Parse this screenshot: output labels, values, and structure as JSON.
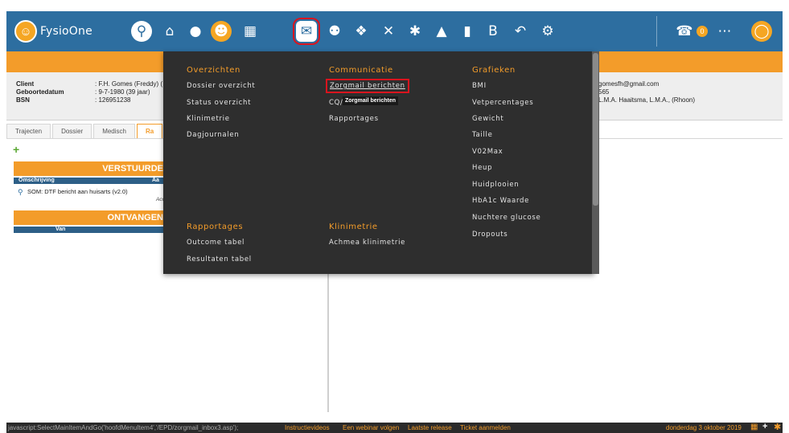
{
  "app": {
    "logo_text": "FysioOne"
  },
  "nav": {
    "icons": [
      "search-icon",
      "home-icon",
      "person-icon",
      "group-icon",
      "calendar-icon",
      "mail-icon",
      "money-icon",
      "handshake-icon",
      "exercise-icon",
      "body-icon",
      "organization-icon",
      "chart-icon",
      "b-icon",
      "back-icon",
      "settings-icon",
      "support-icon",
      "more-icon",
      "user-icon"
    ],
    "badge": "0"
  },
  "client": {
    "label_client": "Client",
    "label_birth": "Geboortedatum",
    "label_bsn": "BSN",
    "value_client": ": F.H. Gomes (Freddy) (",
    "value_birth": ": 9-7-1980 (39 jaar)",
    "value_bsn": ": 126951238",
    "right_email": "gomesfh@gmail.com",
    "right_phone": "565",
    "right_practitioner": "L.M.A. Haaitsma, L.M.A., (Rhoon)"
  },
  "tabs": [
    "Trajecten",
    "Dossier",
    "Medisch",
    "Ra"
  ],
  "left_panel": {
    "sent_title": "VERSTUURDE",
    "sent_col_desc": "Omschrijving",
    "sent_col_aan": "Aa",
    "sent_row_desc": "SOM: DTF bericht aan huisarts (v2.0)",
    "sent_row_meta": "Acc",
    "received_title": "ONTVANGEN",
    "received_col_van": "Van"
  },
  "dropdown": {
    "col1_title": "Overzichten",
    "col1_items": [
      "Dossier overzicht",
      "Status overzicht",
      "Klinimetrie",
      "Dagjournalen"
    ],
    "col2_title": "Communicatie",
    "col2_items": [
      "Zorgmail berichten",
      "CQ/FP",
      "Rapportages"
    ],
    "tooltip": "Zorgmail berichten",
    "col3_title": "Grafieken",
    "col3_items": [
      "BMI",
      "Vetpercentages",
      "Gewicht",
      "Taille",
      "V02Max",
      "Heup",
      "Huidplooien",
      "HbA1c Waarde",
      "Nuchtere glucose",
      "Dropouts"
    ],
    "col4_title": "Rapportages",
    "col4_items": [
      "Outcome tabel",
      "Resultaten tabel"
    ],
    "col5_title": "Klinimetrie",
    "col5_items": [
      "Achmea klinimetrie"
    ]
  },
  "statusbar": {
    "url": "javascript:SelectMainItemAndGo('hoofdMenuItem4','/EPD/zorgmail_inbox3.asp');",
    "links": [
      "Instructievideos",
      "Een webinar volgen",
      "Laatste release",
      "Ticket aanmelden"
    ],
    "date": "donderdag 3 oktober 2019"
  }
}
